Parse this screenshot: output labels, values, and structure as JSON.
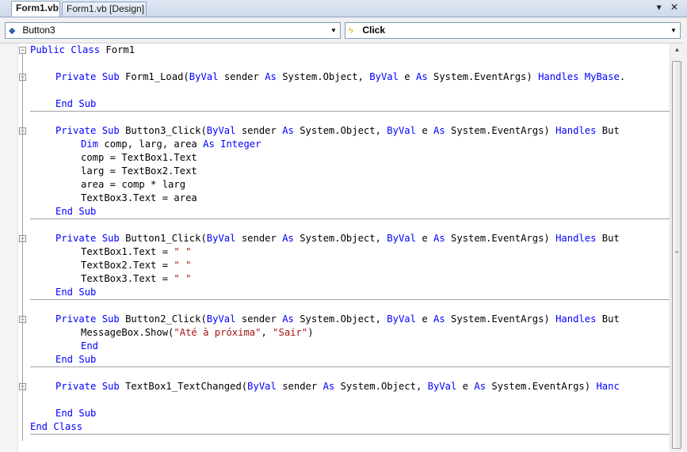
{
  "tabs": [
    {
      "label": "Form1.vb",
      "active": true
    },
    {
      "label": "Form1.vb [Design]",
      "active": false
    }
  ],
  "tab_controls": {
    "dropdown_glyph": "▾",
    "close_glyph": "✕"
  },
  "navbar": {
    "object_combo": {
      "value": "Button3",
      "icon": "control-icon"
    },
    "event_combo": {
      "value": "Click",
      "icon": "lightning-icon"
    },
    "arrow_glyph": "▼"
  },
  "code": {
    "lines": [
      {
        "indent": 0,
        "tokens": [
          [
            "kw",
            "Public "
          ],
          [
            "kw",
            "Class "
          ],
          [
            "t",
            "Form1"
          ]
        ]
      },
      {
        "indent": 0,
        "tokens": []
      },
      {
        "indent": 1,
        "tokens": [
          [
            "kw",
            "Private "
          ],
          [
            "kw",
            "Sub "
          ],
          [
            "t",
            "Form1_Load("
          ],
          [
            "kw",
            "ByVal "
          ],
          [
            "t",
            "sender "
          ],
          [
            "kw",
            "As "
          ],
          [
            "t",
            "System.Object, "
          ],
          [
            "kw",
            "ByVal "
          ],
          [
            "t",
            "e "
          ],
          [
            "kw",
            "As "
          ],
          [
            "t",
            "System.EventArgs) "
          ],
          [
            "kw",
            "Handles "
          ],
          [
            "kw",
            "MyBase"
          ],
          [
            "t",
            "."
          ]
        ]
      },
      {
        "indent": 0,
        "tokens": []
      },
      {
        "indent": 1,
        "tokens": [
          [
            "kw",
            "End "
          ],
          [
            "kw",
            "Sub"
          ]
        ]
      },
      {
        "indent": 0,
        "tokens": []
      },
      {
        "indent": 1,
        "tokens": [
          [
            "kw",
            "Private "
          ],
          [
            "kw",
            "Sub "
          ],
          [
            "t",
            "Button3_Click("
          ],
          [
            "kw",
            "ByVal "
          ],
          [
            "t",
            "sender "
          ],
          [
            "kw",
            "As "
          ],
          [
            "t",
            "System.Object, "
          ],
          [
            "kw",
            "ByVal "
          ],
          [
            "t",
            "e "
          ],
          [
            "kw",
            "As "
          ],
          [
            "t",
            "System.EventArgs) "
          ],
          [
            "kw",
            "Handles "
          ],
          [
            "t",
            "But"
          ]
        ]
      },
      {
        "indent": 2,
        "tokens": [
          [
            "kw",
            "Dim "
          ],
          [
            "t",
            "comp, larg, area "
          ],
          [
            "kw",
            "As "
          ],
          [
            "kw",
            "Integer"
          ]
        ]
      },
      {
        "indent": 2,
        "tokens": [
          [
            "t",
            "comp = TextBox1.Text"
          ]
        ]
      },
      {
        "indent": 2,
        "tokens": [
          [
            "t",
            "larg = TextBox2.Text"
          ]
        ]
      },
      {
        "indent": 2,
        "tokens": [
          [
            "t",
            "area = comp * larg"
          ]
        ]
      },
      {
        "indent": 2,
        "tokens": [
          [
            "t",
            "TextBox3.Text = area"
          ]
        ]
      },
      {
        "indent": 1,
        "tokens": [
          [
            "kw",
            "End "
          ],
          [
            "kw",
            "Sub"
          ]
        ]
      },
      {
        "indent": 0,
        "tokens": []
      },
      {
        "indent": 1,
        "tokens": [
          [
            "kw",
            "Private "
          ],
          [
            "kw",
            "Sub "
          ],
          [
            "t",
            "Button1_Click("
          ],
          [
            "kw",
            "ByVal "
          ],
          [
            "t",
            "sender "
          ],
          [
            "kw",
            "As "
          ],
          [
            "t",
            "System.Object, "
          ],
          [
            "kw",
            "ByVal "
          ],
          [
            "t",
            "e "
          ],
          [
            "kw",
            "As "
          ],
          [
            "t",
            "System.EventArgs) "
          ],
          [
            "kw",
            "Handles "
          ],
          [
            "t",
            "But"
          ]
        ]
      },
      {
        "indent": 2,
        "tokens": [
          [
            "t",
            "TextBox1.Text = "
          ],
          [
            "str",
            "\" \""
          ]
        ]
      },
      {
        "indent": 2,
        "tokens": [
          [
            "t",
            "TextBox2.Text = "
          ],
          [
            "str",
            "\" \""
          ]
        ]
      },
      {
        "indent": 2,
        "tokens": [
          [
            "t",
            "TextBox3.Text = "
          ],
          [
            "str",
            "\" \""
          ]
        ]
      },
      {
        "indent": 1,
        "tokens": [
          [
            "kw",
            "End "
          ],
          [
            "kw",
            "Sub"
          ]
        ]
      },
      {
        "indent": 0,
        "tokens": []
      },
      {
        "indent": 1,
        "tokens": [
          [
            "kw",
            "Private "
          ],
          [
            "kw",
            "Sub "
          ],
          [
            "t",
            "Button2_Click("
          ],
          [
            "kw",
            "ByVal "
          ],
          [
            "t",
            "sender "
          ],
          [
            "kw",
            "As "
          ],
          [
            "t",
            "System.Object, "
          ],
          [
            "kw",
            "ByVal "
          ],
          [
            "t",
            "e "
          ],
          [
            "kw",
            "As "
          ],
          [
            "t",
            "System.EventArgs) "
          ],
          [
            "kw",
            "Handles "
          ],
          [
            "t",
            "But"
          ]
        ]
      },
      {
        "indent": 2,
        "tokens": [
          [
            "t",
            "MessageBox.Show("
          ],
          [
            "str",
            "\"Até à próxima\""
          ],
          [
            "t",
            ", "
          ],
          [
            "str",
            "\"Sair\""
          ],
          [
            "t",
            ")"
          ]
        ]
      },
      {
        "indent": 2,
        "tokens": [
          [
            "kw",
            "End"
          ]
        ]
      },
      {
        "indent": 1,
        "tokens": [
          [
            "kw",
            "End "
          ],
          [
            "kw",
            "Sub"
          ]
        ]
      },
      {
        "indent": 0,
        "tokens": []
      },
      {
        "indent": 1,
        "tokens": [
          [
            "kw",
            "Private "
          ],
          [
            "kw",
            "Sub "
          ],
          [
            "t",
            "TextBox1_TextChanged("
          ],
          [
            "kw",
            "ByVal "
          ],
          [
            "t",
            "sender "
          ],
          [
            "kw",
            "As "
          ],
          [
            "t",
            "System.Object, "
          ],
          [
            "kw",
            "ByVal "
          ],
          [
            "t",
            "e "
          ],
          [
            "kw",
            "As "
          ],
          [
            "t",
            "System.EventArgs) "
          ],
          [
            "kw",
            "Hanc"
          ]
        ]
      },
      {
        "indent": 0,
        "tokens": []
      },
      {
        "indent": 1,
        "tokens": [
          [
            "kw",
            "End "
          ],
          [
            "kw",
            "Sub"
          ]
        ]
      },
      {
        "indent": 0,
        "tokens": [
          [
            "kw",
            "End "
          ],
          [
            "kw",
            "Class"
          ]
        ]
      }
    ],
    "colors": {
      "keyword": "#0000ff",
      "string": "#a31515",
      "text": "#000000"
    }
  },
  "scrollbar": {
    "up_glyph": "▲",
    "down_glyph": "▼",
    "grip_glyph": "≡"
  }
}
